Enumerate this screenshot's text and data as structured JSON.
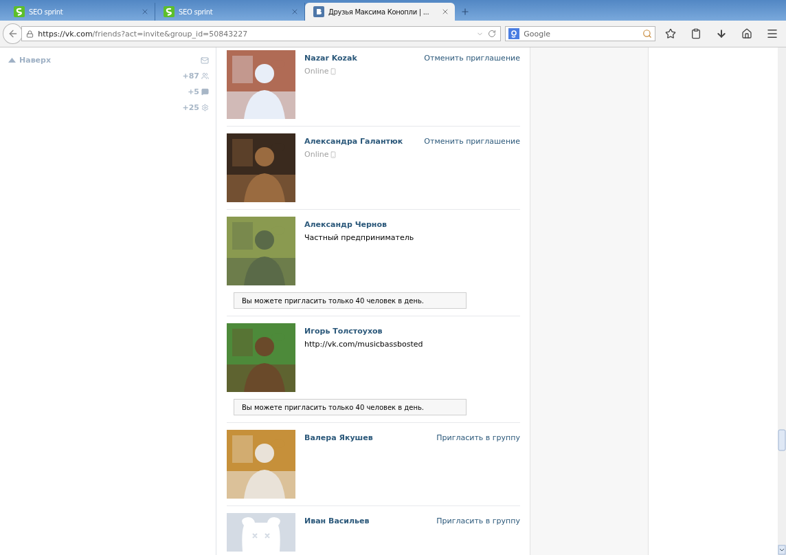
{
  "tabs": [
    {
      "label": "SEO sprint",
      "selected": false
    },
    {
      "label": "SEO sprint",
      "selected": false
    },
    {
      "label": "Друзья Максима Конопли | ...",
      "selected": true
    }
  ],
  "address_bar": {
    "url_host": "https://vk.com",
    "url_path": "/friends?act=invite&group_id=50843227"
  },
  "search": {
    "placeholder": "Google"
  },
  "sidebar": {
    "top_link": "Наверх",
    "counters": [
      {
        "count": "+87",
        "kind": "friends"
      },
      {
        "count": "+5",
        "kind": "comments"
      },
      {
        "count": "+25",
        "kind": "settings"
      }
    ]
  },
  "friends": [
    {
      "name": "Nazar Kozak",
      "kind": "online",
      "subtitle": "Online",
      "action": "Отменить приглашение"
    },
    {
      "name": "Александра Галантюк",
      "kind": "online",
      "subtitle": "Online",
      "action": "Отменить приглашение"
    },
    {
      "name": "Александр Чернов",
      "kind": "text",
      "subtitle": "Частный предприниматель",
      "notice": "Вы можете пригласить только 40 человек в день."
    },
    {
      "name": "Игорь Толстоухов",
      "kind": "text",
      "subtitle": "http://vk.com/musicbassbosted",
      "notice": "Вы можете пригласить только 40 человек в день."
    },
    {
      "name": "Валера Якушев",
      "action": "Пригласить в группу"
    },
    {
      "name": "Иван Васильев",
      "action": "Пригласить в группу"
    }
  ]
}
